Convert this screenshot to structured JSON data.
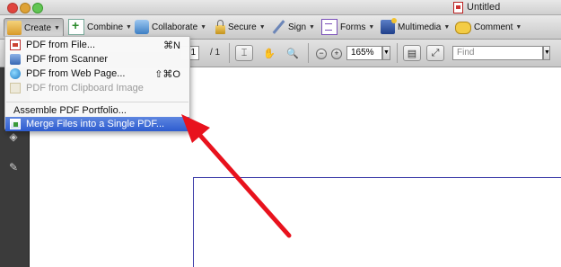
{
  "window": {
    "title": "Untitled"
  },
  "toolbar": {
    "create_label": "Create",
    "combine_label": "Combine",
    "collaborate_label": "Collaborate",
    "secure_label": "Secure",
    "sign_label": "Sign",
    "forms_label": "Forms",
    "multimedia_label": "Multimedia",
    "comment_label": "Comment"
  },
  "navbar": {
    "page_number": "1",
    "page_total": "/ 1",
    "zoom_value": "165%",
    "find_placeholder": "Find"
  },
  "create_menu": {
    "items": [
      {
        "label": "PDF from File...",
        "shortcut": "⌘N",
        "icon": "pdf-file-icon"
      },
      {
        "label": "PDF from Scanner",
        "shortcut": "",
        "icon": "scanner-icon"
      },
      {
        "label": "PDF from Web Page...",
        "shortcut": "⇧⌘O",
        "icon": "web-page-icon"
      },
      {
        "label": "PDF from Clipboard Image",
        "shortcut": "",
        "icon": "clipboard-icon",
        "disabled": true
      },
      {
        "label": "Assemble PDF Portfolio...",
        "shortcut": ""
      },
      {
        "label": "Merge Files into a Single PDF...",
        "shortcut": "",
        "icon": "merge-icon",
        "highlighted": true
      }
    ]
  },
  "colors": {
    "highlight": "#2d5ccf",
    "arrow": "#e8121d",
    "page_edge": "#3b3ba8",
    "sidebar": "#3b3b3b"
  }
}
